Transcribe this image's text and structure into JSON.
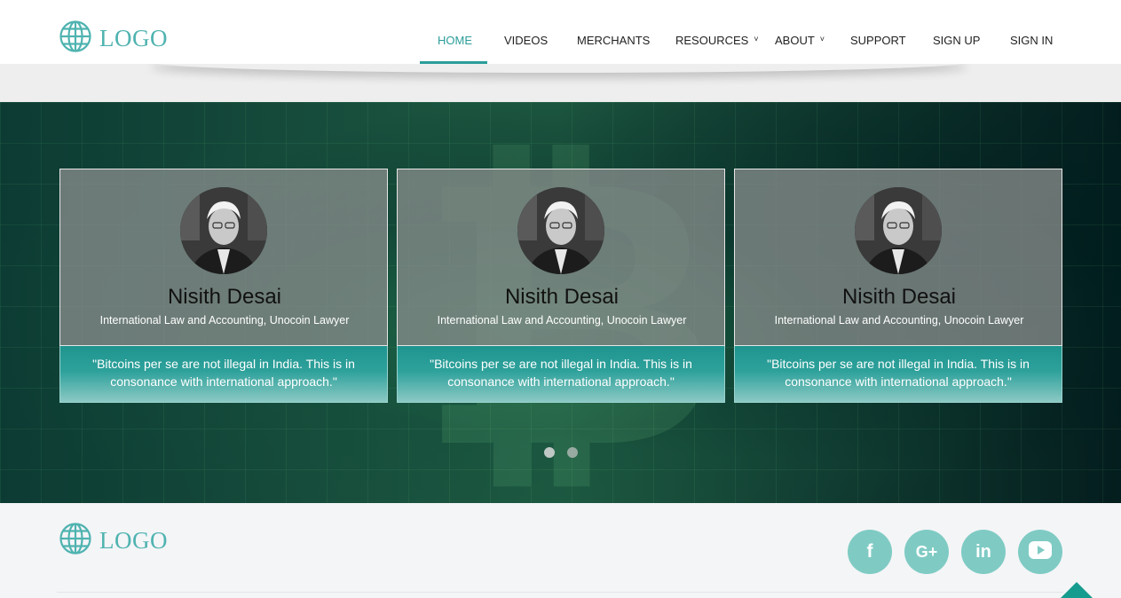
{
  "brand": {
    "logo_text": "LOGO",
    "logo_icon": "globe-icon",
    "accent_color": "#4fb3b0"
  },
  "nav": {
    "items": [
      {
        "label": "HOME",
        "active": true
      },
      {
        "label": "VIDEOS"
      },
      {
        "label": "MERCHANTS"
      },
      {
        "label": "RESOURCES",
        "dropdown": true
      },
      {
        "label": "ABOUT",
        "dropdown": true
      },
      {
        "label": "SUPPORT"
      },
      {
        "label": "SIGN UP"
      },
      {
        "label": "SIGN IN"
      }
    ],
    "caret_glyph": "˅"
  },
  "testimonials": [
    {
      "name": "Nisith Desai",
      "role": "International Law and Accounting, Unocoin Lawyer",
      "quote": "\"Bitcoins per se are not illegal in India. This is in consonance with international approach.\""
    },
    {
      "name": "Nisith Desai",
      "role": "International Law and Accounting, Unocoin Lawyer",
      "quote": "\"Bitcoins per se are not illegal in India. This is in consonance with international approach.\""
    },
    {
      "name": "Nisith Desai",
      "role": "International Law and Accounting, Unocoin Lawyer",
      "quote": "\"Bitcoins per se are not illegal in India. This is in consonance with international approach.\""
    }
  ],
  "carousel": {
    "slides": 2,
    "active_slide": 1
  },
  "footer": {
    "logo_text": "LOGO",
    "social": [
      {
        "icon": "facebook-icon",
        "glyph": "f"
      },
      {
        "icon": "google-plus-icon",
        "glyph": "G+"
      },
      {
        "icon": "linkedin-icon",
        "glyph": "in"
      },
      {
        "icon": "youtube-icon",
        "glyph": "▶"
      }
    ],
    "back_to_top_color": "#159c8e"
  }
}
